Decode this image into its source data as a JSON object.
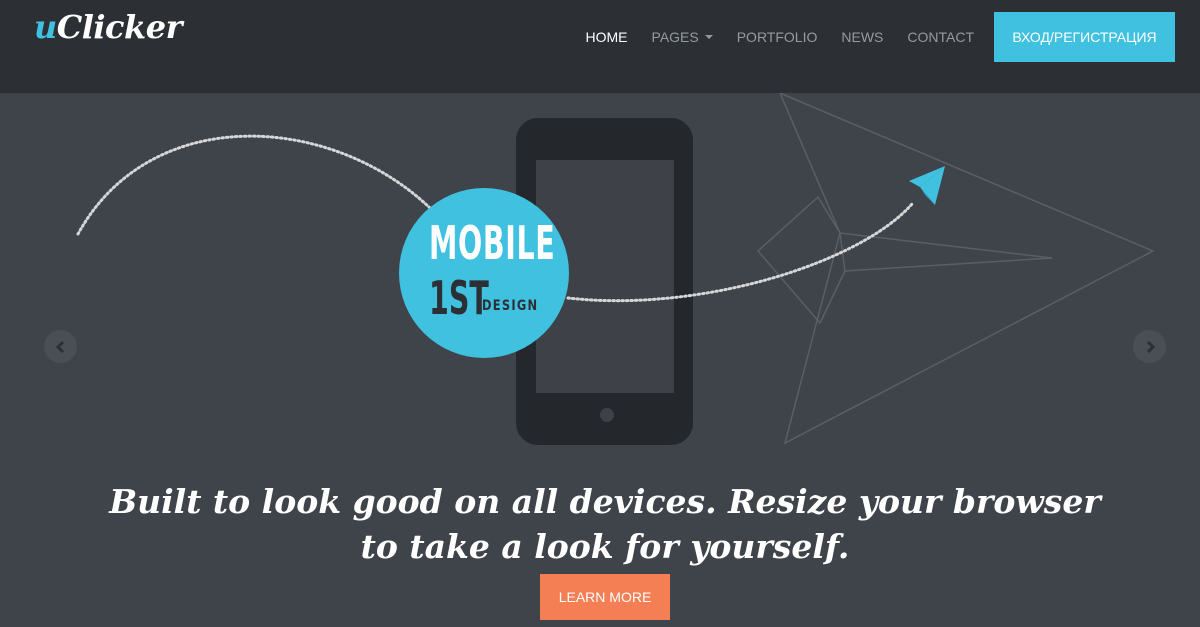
{
  "header": {
    "logo_prefix": "u",
    "logo_rest": "Clicker",
    "nav": {
      "home": "HOME",
      "pages": "PAGES",
      "portfolio": "PORTFOLIO",
      "news": "NEWS",
      "contact": "CONTACT"
    },
    "login_label": "ВХОД/РЕГИСТРАЦИЯ"
  },
  "hero": {
    "badge": {
      "line1": "MOBILE",
      "line2": "1ST",
      "line3": "DESIGN"
    },
    "tagline": "Built to look good on all devices. Resize your browser to take a look for yourself.",
    "button_label": "LEARN MORE",
    "icons": {
      "prev": "chevron-left-icon",
      "next": "chevron-right-icon",
      "plane": "paper-plane-icon",
      "phone": "smartphone-icon"
    }
  },
  "colors": {
    "accent": "#3fc1df",
    "cta": "#f47f55",
    "header_bg": "#2c3035",
    "hero_bg": "#3f434a"
  }
}
